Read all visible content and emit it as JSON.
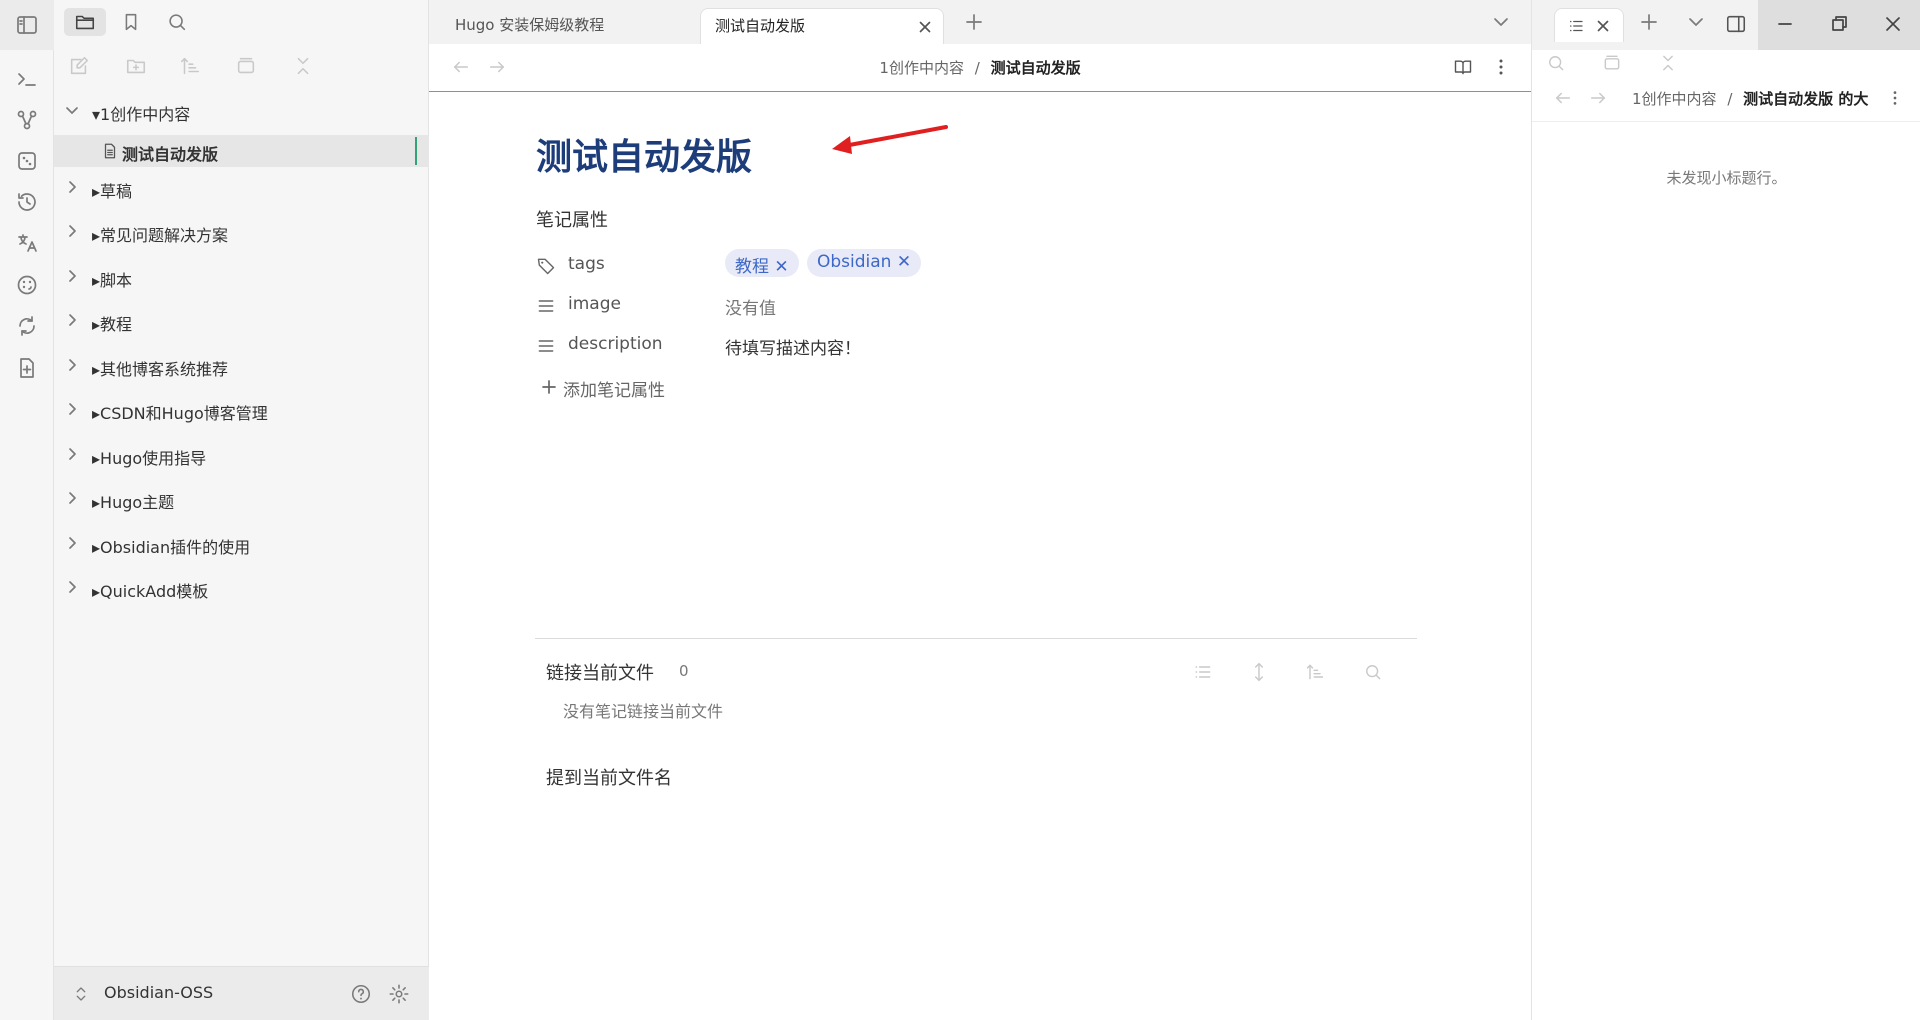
{
  "tabs": [
    {
      "label": "Hugo 安装保姆级教程",
      "active": false
    },
    {
      "label": "测试自动发版",
      "active": true
    }
  ],
  "breadcrumb": {
    "folder": "1创作中内容",
    "separator": "/",
    "file": "测试自动发版"
  },
  "file_tree": [
    {
      "label": "▾1创作中内容",
      "type": "folder",
      "expanded": true
    },
    {
      "label": "测试自动发版",
      "type": "file",
      "active": true
    },
    {
      "label": "▸草稿",
      "type": "folder"
    },
    {
      "label": "▸常见问题解决方案",
      "type": "folder"
    },
    {
      "label": "▸脚本",
      "type": "folder"
    },
    {
      "label": "▸教程",
      "type": "folder"
    },
    {
      "label": "▸其他博客系统推荐",
      "type": "folder"
    },
    {
      "label": "▸CSDN和Hugo博客管理",
      "type": "folder"
    },
    {
      "label": "▸Hugo使用指导",
      "type": "folder"
    },
    {
      "label": "▸Hugo主题",
      "type": "folder"
    },
    {
      "label": "▸Obsidian插件的使用",
      "type": "folder"
    },
    {
      "label": "▸QuickAdd模板",
      "type": "folder"
    }
  ],
  "vault": {
    "name": "Obsidian-OSS"
  },
  "note": {
    "title": "测试自动发版",
    "properties_heading": "笔记属性",
    "properties": [
      {
        "key": "tags",
        "icon": "tag-icon",
        "tags": [
          "教程 ✕",
          "Obsidian ✕"
        ]
      },
      {
        "key": "image",
        "icon": "text-icon",
        "value": "没有值"
      },
      {
        "key": "description",
        "icon": "text-icon",
        "value": "待填写描述内容！"
      }
    ],
    "add_property": "添加笔记属性",
    "backlinks": {
      "heading": "链接当前文件",
      "count": "0",
      "empty": "没有笔记链接当前文件"
    },
    "mentions": {
      "heading": "提到当前文件名"
    }
  },
  "outline": {
    "breadcrumb_folder": "1创作中内容",
    "breadcrumb_separator": "/",
    "breadcrumb_file": "测试自动发版 的大",
    "empty": "未发现小标题行。"
  },
  "colors": {
    "accent": "#33a17a",
    "title": "#1d3d7a",
    "tag_bg": "#e9eaf7",
    "tag_text": "#3d68c8",
    "arrow": "#e02020"
  }
}
